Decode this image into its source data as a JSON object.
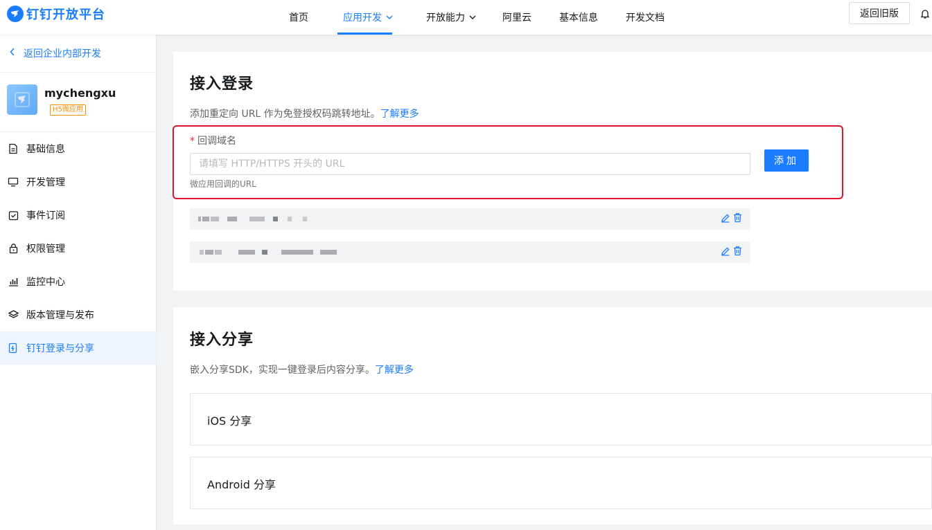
{
  "brand": {
    "name": "钉钉开放平台",
    "color": "#1a7dff"
  },
  "nav": {
    "items": [
      {
        "label": "首页"
      },
      {
        "label": "应用开发",
        "active": true
      },
      {
        "label": "开放能力"
      },
      {
        "label": "阿里云"
      },
      {
        "label": "基本信息"
      },
      {
        "label": "开发文档"
      }
    ],
    "back_old_label": "返回旧版"
  },
  "sidebar": {
    "back_label": "返回企业内部开发",
    "app": {
      "name": "mychengxu",
      "tag": "H5微应用"
    },
    "items": [
      {
        "label": "基础信息",
        "icon": "document-icon"
      },
      {
        "label": "开发管理",
        "icon": "monitor-icon"
      },
      {
        "label": "事件订阅",
        "icon": "calendar-check-icon"
      },
      {
        "label": "权限管理",
        "icon": "lock-icon"
      },
      {
        "label": "监控中心",
        "icon": "bar-chart-icon"
      },
      {
        "label": "版本管理与发布",
        "icon": "layers-icon"
      },
      {
        "label": "钉钉登录与分享",
        "icon": "login-share-icon",
        "active": true
      }
    ]
  },
  "login": {
    "title": "接入登录",
    "desc": "添加重定向 URL 作为免登授权码跳转地址。",
    "learn_more": "了解更多",
    "field_label": "回调域名",
    "required_mark": "*",
    "input_placeholder": "请填写 HTTP/HTTPS 开头的 URL",
    "input_value": "",
    "hint": "微应用回调的URL",
    "add_label": "添加"
  },
  "share": {
    "title": "接入分享",
    "desc": "嵌入分享SDK，实现一键登录后内容分享。",
    "learn_more": "了解更多",
    "cards": [
      {
        "label": "iOS 分享"
      },
      {
        "label": "Android 分享"
      }
    ]
  },
  "colors": {
    "accent": "#1a7dff",
    "highlight": "#e0112d",
    "tag": "#ff8a00"
  }
}
